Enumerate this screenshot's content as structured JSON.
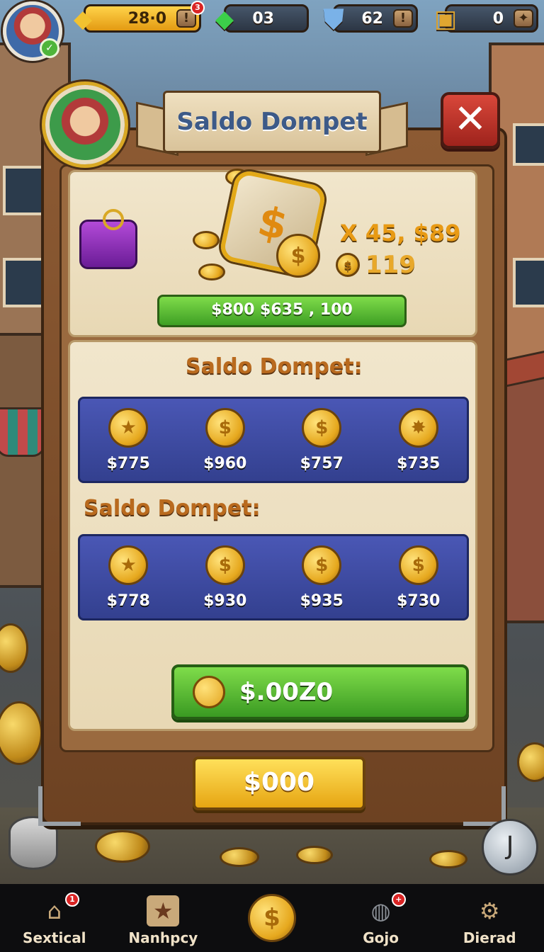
{
  "hud": {
    "gold_value": "28·0",
    "gold_notification": "3",
    "gems_value": "03",
    "shield_value": "62",
    "crate_value": "0",
    "plus_symbol": "!"
  },
  "panel": {
    "title": "Saldo Dompet",
    "close_symbol": "✕",
    "avatar_symbol": "0"
  },
  "summary": {
    "multiplier_text": "X 45, $89",
    "coin_count": "119",
    "green_bar_text": "$800 $635 , 100"
  },
  "sections": [
    {
      "title": "Saldo Dompet:",
      "items": [
        {
          "icon": "coin-star-icon",
          "value": "$775"
        },
        {
          "icon": "dollar-coin-icon",
          "value": "$960"
        },
        {
          "icon": "dollar-coin-icon",
          "value": "$757"
        },
        {
          "icon": "gold-pot-icon",
          "value": "$735"
        }
      ]
    },
    {
      "title": "Saldo Dompet:",
      "items": [
        {
          "icon": "coin-star-icon",
          "value": "$778"
        },
        {
          "icon": "dollar-coin-icon",
          "value": "$930"
        },
        {
          "icon": "dollar-coin-icon",
          "value": "$935"
        },
        {
          "icon": "dollar-coin-icon",
          "value": "$730"
        }
      ]
    }
  ],
  "buttons": {
    "green_label": "$.00Z0",
    "yellow_label": "$000"
  },
  "nav": {
    "items": [
      {
        "label": "Sextical",
        "badge": "1"
      },
      {
        "label": "Nanhpcy",
        "badge": ""
      },
      {
        "label": "",
        "badge": ""
      },
      {
        "label": "Gojo",
        "badge": "+"
      },
      {
        "label": "Dierad",
        "badge": ""
      }
    ]
  },
  "colors": {
    "accent_gold": "#e6a512",
    "accent_green": "#3e9f24",
    "row_blue": "#3f4ca3",
    "close_red": "#c0352a"
  }
}
